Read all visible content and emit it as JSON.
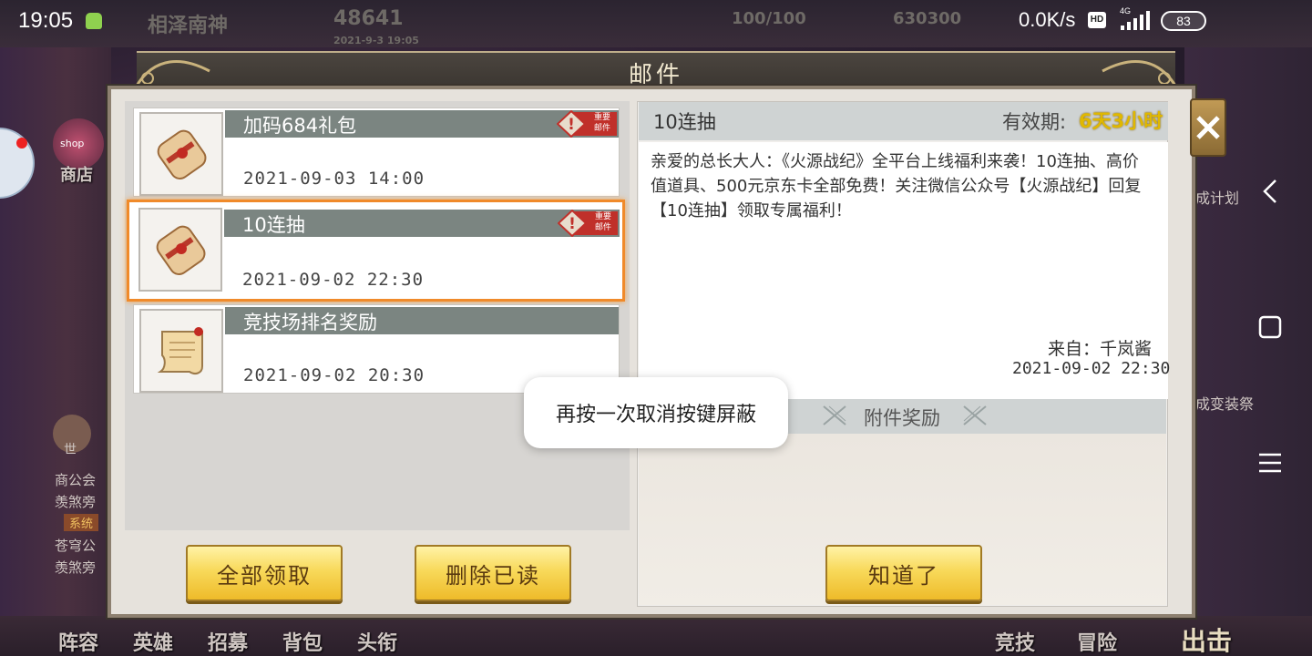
{
  "status_bar": {
    "time": "19:05",
    "net_speed": "0.0K/s",
    "hd_label": "HD",
    "network_type": "4G",
    "battery": "83"
  },
  "game_hud": {
    "player_name": "相泽南神",
    "power": "48641",
    "timestamp": "2021-9-3 19:05",
    "stamina": "100/100",
    "gold": "630300",
    "shop_label": "商店",
    "shop_tag": "shop",
    "chat_lines": [
      "商公会",
      "羡煞旁",
      "系统",
      "苍穹公",
      "羡煞旁"
    ],
    "voice_label": "世",
    "right_labels": [
      "成计划",
      "成变装祭"
    ],
    "bottom_nav": [
      "阵容",
      "英雄",
      "招募",
      "背包",
      "头衔"
    ],
    "bottom_nav_right": [
      "竞技",
      "冒险"
    ],
    "go_label": "出击"
  },
  "dialog": {
    "title": "邮件",
    "mails": [
      {
        "title": "加码684礼包",
        "date": "2021-09-03  14:00",
        "badge": "重要邮件",
        "badge_top": "重要",
        "badge_bottom": "邮件",
        "icon": "scroll-gift-icon"
      },
      {
        "title": "10连抽",
        "date": "2021-09-02  22:30",
        "badge": "重要邮件",
        "badge_top": "重要",
        "badge_bottom": "邮件",
        "icon": "scroll-gift-icon",
        "selected": true
      },
      {
        "title": "竞技场排名奖励",
        "date": "2021-09-02  20:30",
        "icon": "open-scroll-icon"
      }
    ],
    "buttons": {
      "claim_all": "全部领取",
      "delete_read": "删除已读",
      "got_it": "知道了"
    },
    "detail": {
      "title": "10连抽",
      "validity_label": "有效期:",
      "validity_value": "6天3小时",
      "body": "亲爱的总长大人：《火源战纪》全平台上线福利来袭！10连抽、高价值道具、500元京东卡全部免费！关注微信公众号【火源战纪】回复【10连抽】领取专属福利！",
      "from": "来自：千岚酱",
      "from_date": "2021-09-02 22:30",
      "attachment_label": "附件奖励"
    }
  },
  "toast": {
    "message": "再按一次取消按键屏蔽"
  },
  "colors": {
    "accent_orange": "#f08a2a",
    "validity_gold": "#e0b800",
    "header_gray": "#7b8581",
    "badge_red": "#c0302a"
  }
}
